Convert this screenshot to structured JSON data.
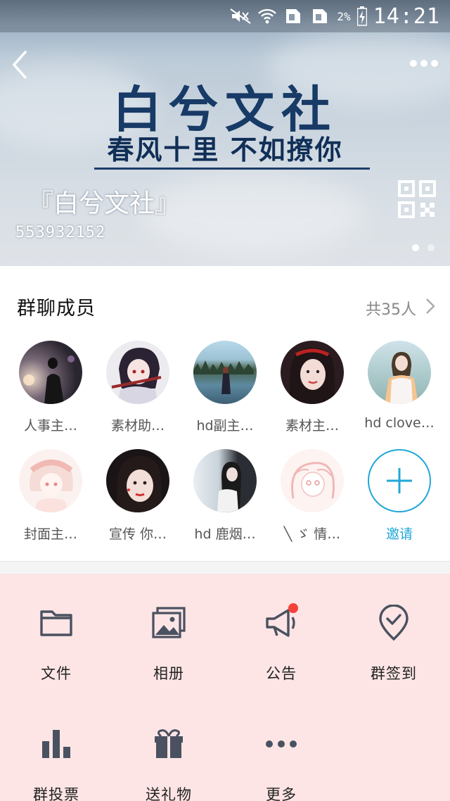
{
  "status_bar": {
    "battery_percent": "2%",
    "time": "14:21"
  },
  "header": {
    "poster_title": "白兮文社",
    "poster_subtitle": "春风十里 不如撩你",
    "group_name": "『白兮文社』",
    "group_id": "553932152",
    "carousel_pages": 2,
    "carousel_active": 1
  },
  "members": {
    "title": "群聊成员",
    "count_label": "共35人",
    "list": [
      {
        "name": "人事主…",
        "avatar": "dark-night-photo"
      },
      {
        "name": "素材助…",
        "avatar": "anime-girl-dark-hair"
      },
      {
        "name": "hd副主…",
        "avatar": "lake-forest-photo"
      },
      {
        "name": "素材主…",
        "avatar": "girl-portrait"
      },
      {
        "name": "hd clove…",
        "avatar": "girl-sweater-photo"
      },
      {
        "name": "封面主…",
        "avatar": "anime-girl-pink"
      },
      {
        "name": "宣传 你…",
        "avatar": "girl-closeup"
      },
      {
        "name": "hd 鹿烟…",
        "avatar": "girl-dark-room"
      },
      {
        "name": "╲ ゞ 情…",
        "avatar": "anime-sketch-girl"
      }
    ],
    "invite_label": "邀请"
  },
  "tools": [
    {
      "label": "文件",
      "icon": "folder-icon",
      "badge": false
    },
    {
      "label": "相册",
      "icon": "album-icon",
      "badge": false
    },
    {
      "label": "公告",
      "icon": "megaphone-icon",
      "badge": true
    },
    {
      "label": "群签到",
      "icon": "checkin-pin-icon",
      "badge": false
    },
    {
      "label": "群投票",
      "icon": "bar-chart-icon",
      "badge": false
    },
    {
      "label": "送礼物",
      "icon": "gift-icon",
      "badge": false
    },
    {
      "label": "更多",
      "icon": "more-dots-icon",
      "badge": false
    }
  ],
  "colors": {
    "accent": "#21a7d8",
    "tool_background": "#fde5e5",
    "icon_gray": "#4a5160",
    "badge_red": "#f5413a",
    "poster_navy": "#173a66"
  }
}
